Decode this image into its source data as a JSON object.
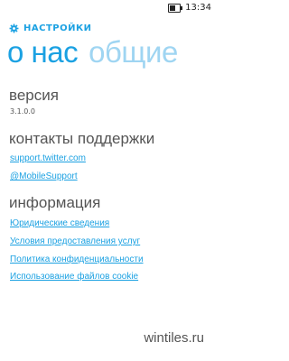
{
  "status_bar": {
    "time": "13:34"
  },
  "header": {
    "app_title": "НАСТРОЙКИ",
    "icon": "gear-icon"
  },
  "pivot": {
    "tabs": [
      {
        "label": "о нас"
      },
      {
        "label": "общие"
      }
    ]
  },
  "sections": {
    "version": {
      "title": "версия",
      "value": "3.1.0.0"
    },
    "support": {
      "title": "контакты поддержки",
      "links": [
        "support.twitter.com",
        "@MobileSupport"
      ]
    },
    "info": {
      "title": "информация",
      "links": [
        "Юридические сведения",
        "Условия предоставления услуг",
        "Политика конфиденциальности",
        "Использование файлов cookie"
      ]
    }
  },
  "watermark": "wintiles.ru",
  "colors": {
    "accent": "#1ba1e2",
    "accent_light": "#9fd5f2",
    "text": "#555555",
    "background": "#ffffff"
  }
}
